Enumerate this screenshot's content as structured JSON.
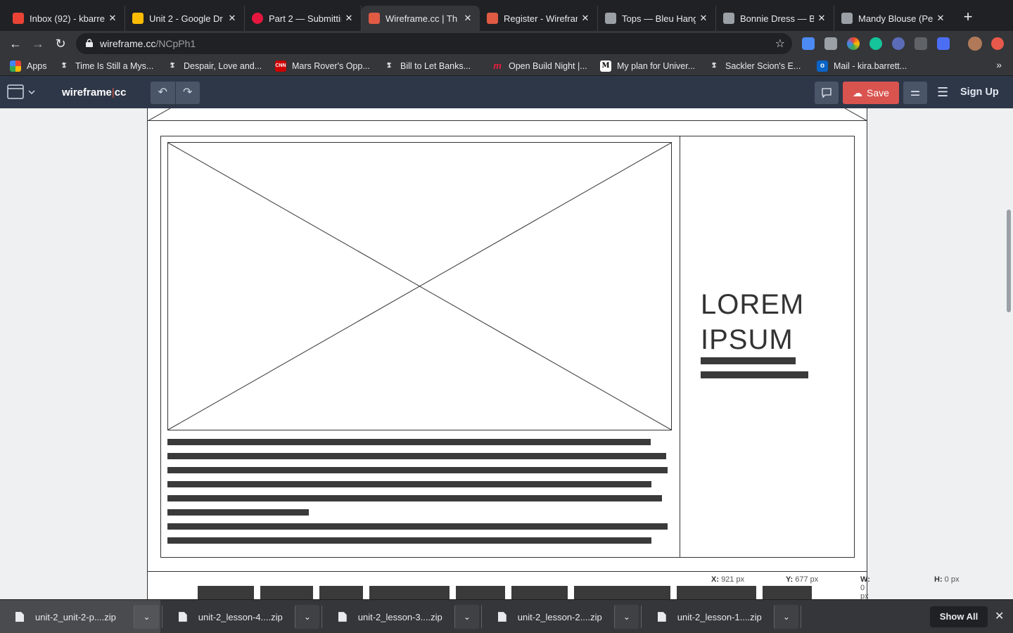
{
  "browser": {
    "tabs": [
      {
        "title": "Inbox (92) - kbarre",
        "color": "#ea4335"
      },
      {
        "title": "Unit 2 - Google Dr",
        "color": "#fbbc04"
      },
      {
        "title": "Part 2 — Submittin",
        "color": "#e5173f"
      },
      {
        "title": "Wireframe.cc | Th",
        "color": "#e05a44",
        "active": true
      },
      {
        "title": "Register - Wirefran",
        "color": "#e05a44"
      },
      {
        "title": "Tops — Bleu Hang",
        "color": "#9aa0a6"
      },
      {
        "title": "Bonnie Dress — Bl",
        "color": "#9aa0a6"
      },
      {
        "title": "Mandy Blouse (Pe",
        "color": "#9aa0a6"
      }
    ],
    "new_tab": "+",
    "url_host": "wireframe.cc",
    "url_path": "/NCpPh1",
    "bookmarks": [
      {
        "label": "Apps",
        "icon": "apps-grid"
      },
      {
        "label": "Time Is Still a Mys...",
        "icon": "nyt"
      },
      {
        "label": "Despair, Love and...",
        "icon": "nyt"
      },
      {
        "label": "Mars Rover's Opp...",
        "icon": "cnn"
      },
      {
        "label": "Bill to Let Banks...",
        "icon": "nyt"
      },
      {
        "label": "Open Build Night |...",
        "icon": "meetup"
      },
      {
        "label": "My plan for Univer...",
        "icon": "medium"
      },
      {
        "label": "Sackler Scion's E...",
        "icon": "nyt"
      },
      {
        "label": "Mail - kira.barrett...",
        "icon": "outlook"
      }
    ],
    "more_bookmarks": "»"
  },
  "app": {
    "logo_main": "wireframe",
    "logo_sep": "|",
    "logo_cc": "cc",
    "undo": "↶",
    "redo": "↷",
    "save_label": "Save",
    "signup_label": "Sign Up",
    "accent": "#d9534f"
  },
  "wireframe": {
    "heading_line1": "LOREM",
    "heading_line2": "IPSUM",
    "body_lines": [
      687,
      709,
      711,
      688,
      703,
      201,
      711,
      688
    ],
    "heading_bars": [
      135,
      153
    ],
    "nav_blocks": [
      80,
      75,
      62,
      114,
      70,
      80,
      137,
      113,
      70
    ]
  },
  "status": {
    "x_label": "X:",
    "x_value": "921 px",
    "y_label": "Y:",
    "y_value": "677 px",
    "w_label": "W:",
    "w_value": "0 px",
    "h_label": "H:",
    "h_value": "0 px"
  },
  "downloads": {
    "items": [
      "unit-2_unit-2-p....zip",
      "unit-2_lesson-4....zip",
      "unit-2_lesson-3....zip",
      "unit-2_lesson-2....zip",
      "unit-2_lesson-1....zip"
    ],
    "show_all": "Show All"
  }
}
